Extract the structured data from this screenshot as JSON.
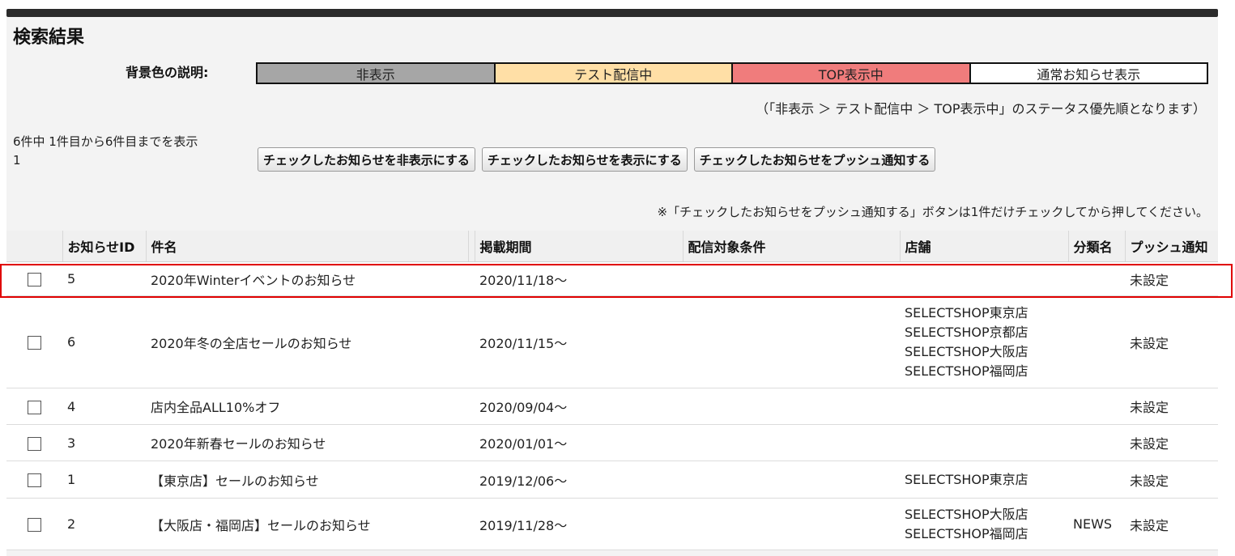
{
  "page_title": "検索結果",
  "legend": {
    "label": "背景色の説明:",
    "items": [
      {
        "label": "非表示",
        "color": "#a6a6a6"
      },
      {
        "label": "テスト配信中",
        "color": "#ffdfa6"
      },
      {
        "label": "TOP表示中",
        "color": "#f07c7c"
      },
      {
        "label": "通常お知らせ表示",
        "color": "#ffffff"
      }
    ]
  },
  "status_note": "（「非表示 ＞ テスト配信中 ＞ TOP表示中」のステータス優先順となります）",
  "count_text": "6件中 1件目から6件目までを表示",
  "page_number": "1",
  "buttons": {
    "hide": "チェックしたお知らせを非表示にする",
    "show": "チェックしたお知らせを表示にする",
    "push": "チェックしたお知らせをプッシュ通知する"
  },
  "push_note": "※「チェックしたお知らせをプッシュ通知する」ボタンは1件だけチェックしてから押してください。",
  "columns": [
    "",
    "お知らせID",
    "件名",
    "",
    "掲載期間",
    "配信対象条件",
    "店舗",
    "分類名",
    "プッシュ通知"
  ],
  "rows": [
    {
      "id": "5",
      "title": "2020年Winterイベントのお知らせ",
      "period": "2020/11/18〜",
      "condition": "",
      "stores": [],
      "category": "",
      "push": "未設定",
      "highlighted": true
    },
    {
      "id": "6",
      "title": "2020年冬の全店セールのお知らせ",
      "period": "2020/11/15〜",
      "condition": "",
      "stores": [
        "SELECTSHOP東京店",
        "SELECTSHOP京都店",
        "SELECTSHOP大阪店",
        "SELECTSHOP福岡店"
      ],
      "category": "",
      "push": "未設定"
    },
    {
      "id": "4",
      "title": "店内全品ALL10%オフ",
      "period": "2020/09/04〜",
      "condition": "",
      "stores": [],
      "category": "",
      "push": "未設定"
    },
    {
      "id": "3",
      "title": "2020年新春セールのお知らせ",
      "period": "2020/01/01〜",
      "condition": "",
      "stores": [],
      "category": "",
      "push": "未設定"
    },
    {
      "id": "1",
      "title": "【東京店】セールのお知らせ",
      "period": "2019/12/06〜",
      "condition": "",
      "stores": [
        "SELECTSHOP東京店"
      ],
      "category": "",
      "push": "未設定"
    },
    {
      "id": "2",
      "title": "【大阪店・福岡店】セールのお知らせ",
      "period": "2019/11/28〜",
      "condition": "",
      "stores": [
        "SELECTSHOP大阪店",
        "SELECTSHOP福岡店"
      ],
      "category": "NEWS",
      "push": "未設定"
    }
  ],
  "highlight_color": "#e00000"
}
